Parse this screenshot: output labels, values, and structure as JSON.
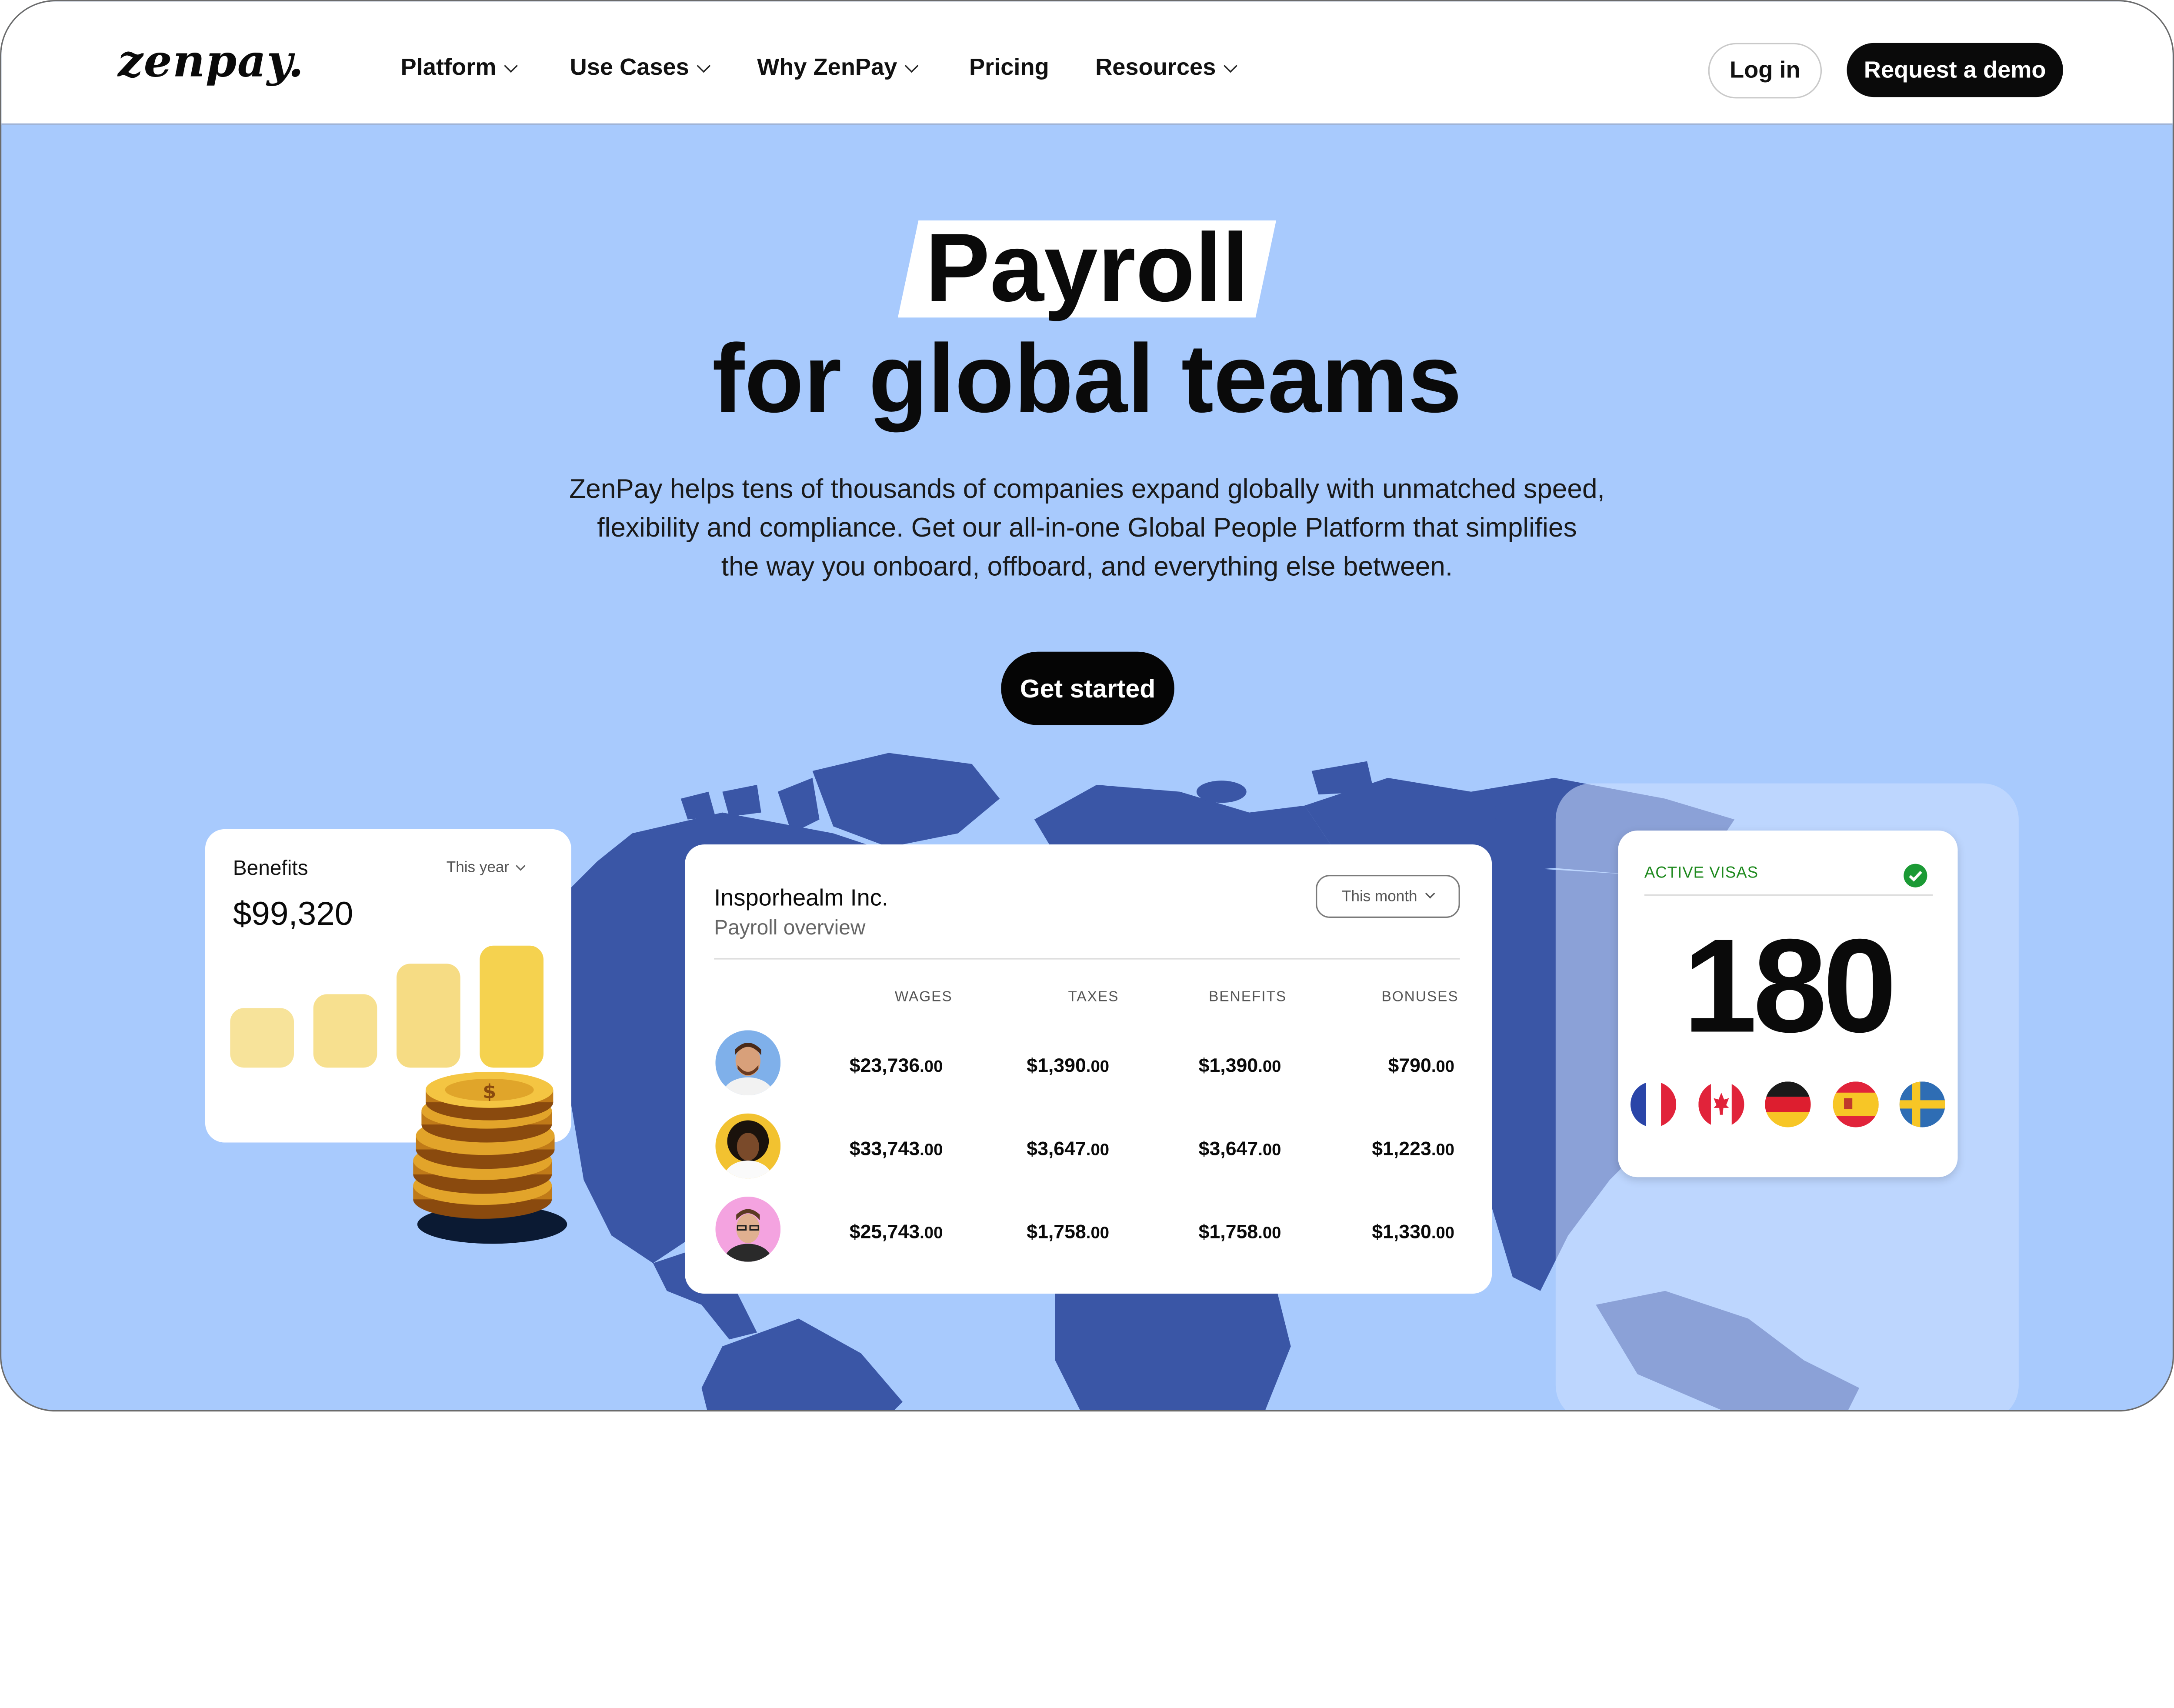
{
  "brand": {
    "logo": "zenpay."
  },
  "nav": {
    "items": [
      {
        "label": "Platform",
        "has_dropdown": true
      },
      {
        "label": "Use Cases",
        "has_dropdown": true
      },
      {
        "label": "Why ZenPay",
        "has_dropdown": true
      },
      {
        "label": "Pricing",
        "has_dropdown": false
      },
      {
        "label": "Resources",
        "has_dropdown": true
      }
    ],
    "login_label": "Log in",
    "demo_label": "Request a demo"
  },
  "hero": {
    "highlight_word": "Payroll",
    "headline_rest": "for global teams",
    "description_lines": [
      "ZenPay helps tens of thousands of companies expand globally with unmatched speed,",
      "flexibility and compliance. Get our all-in-one Global People Platform that simplifies",
      "the way you onboard, offboard, and everything else between."
    ],
    "cta_label": "Get started"
  },
  "benefits_card": {
    "title": "Benefits",
    "range": "This year",
    "amount": "$99,320",
    "bar_levels": [
      0.45,
      0.55,
      0.78,
      0.92
    ],
    "bar_colors": [
      "#f7e39a",
      "#f7e08f",
      "#f6dc84",
      "#f5d24f"
    ]
  },
  "payroll_card": {
    "company": "Insporhealm Inc.",
    "subtitle": "Payroll overview",
    "range": "This month",
    "columns": [
      "WAGES",
      "TAXES",
      "BENEFITS",
      "BONUSES"
    ],
    "rows": [
      {
        "avatar": "person-avatar-1",
        "avatar_bg": "#7fb0ea",
        "cells": [
          [
            "$23,736",
            ".00"
          ],
          [
            "$1,390",
            ".00"
          ],
          [
            "$1,390",
            ".00"
          ],
          [
            "$790",
            ".00"
          ]
        ]
      },
      {
        "avatar": "person-avatar-2",
        "avatar_bg": "#f2c230",
        "cells": [
          [
            "$33,743",
            ".00"
          ],
          [
            "$3,647",
            ".00"
          ],
          [
            "$3,647",
            ".00"
          ],
          [
            "$1,223",
            ".00"
          ]
        ]
      },
      {
        "avatar": "person-avatar-3",
        "avatar_bg": "#f4a3e0",
        "cells": [
          [
            "$25,743",
            ".00"
          ],
          [
            "$1,758",
            ".00"
          ],
          [
            "$1,758",
            ".00"
          ],
          [
            "$1,330",
            ".00"
          ]
        ]
      }
    ]
  },
  "visas_card": {
    "title": "ACTIVE VISAS",
    "count": "180",
    "flags": [
      "france-flag-icon",
      "canada-flag-icon",
      "germany-flag-icon",
      "spain-flag-icon",
      "sweden-flag-icon"
    ]
  },
  "colors": {
    "hero_bg": "#a8cafd",
    "map": "#3a56a6",
    "accent_dark": "#0a0a0a",
    "check_green": "#1b9a35"
  }
}
